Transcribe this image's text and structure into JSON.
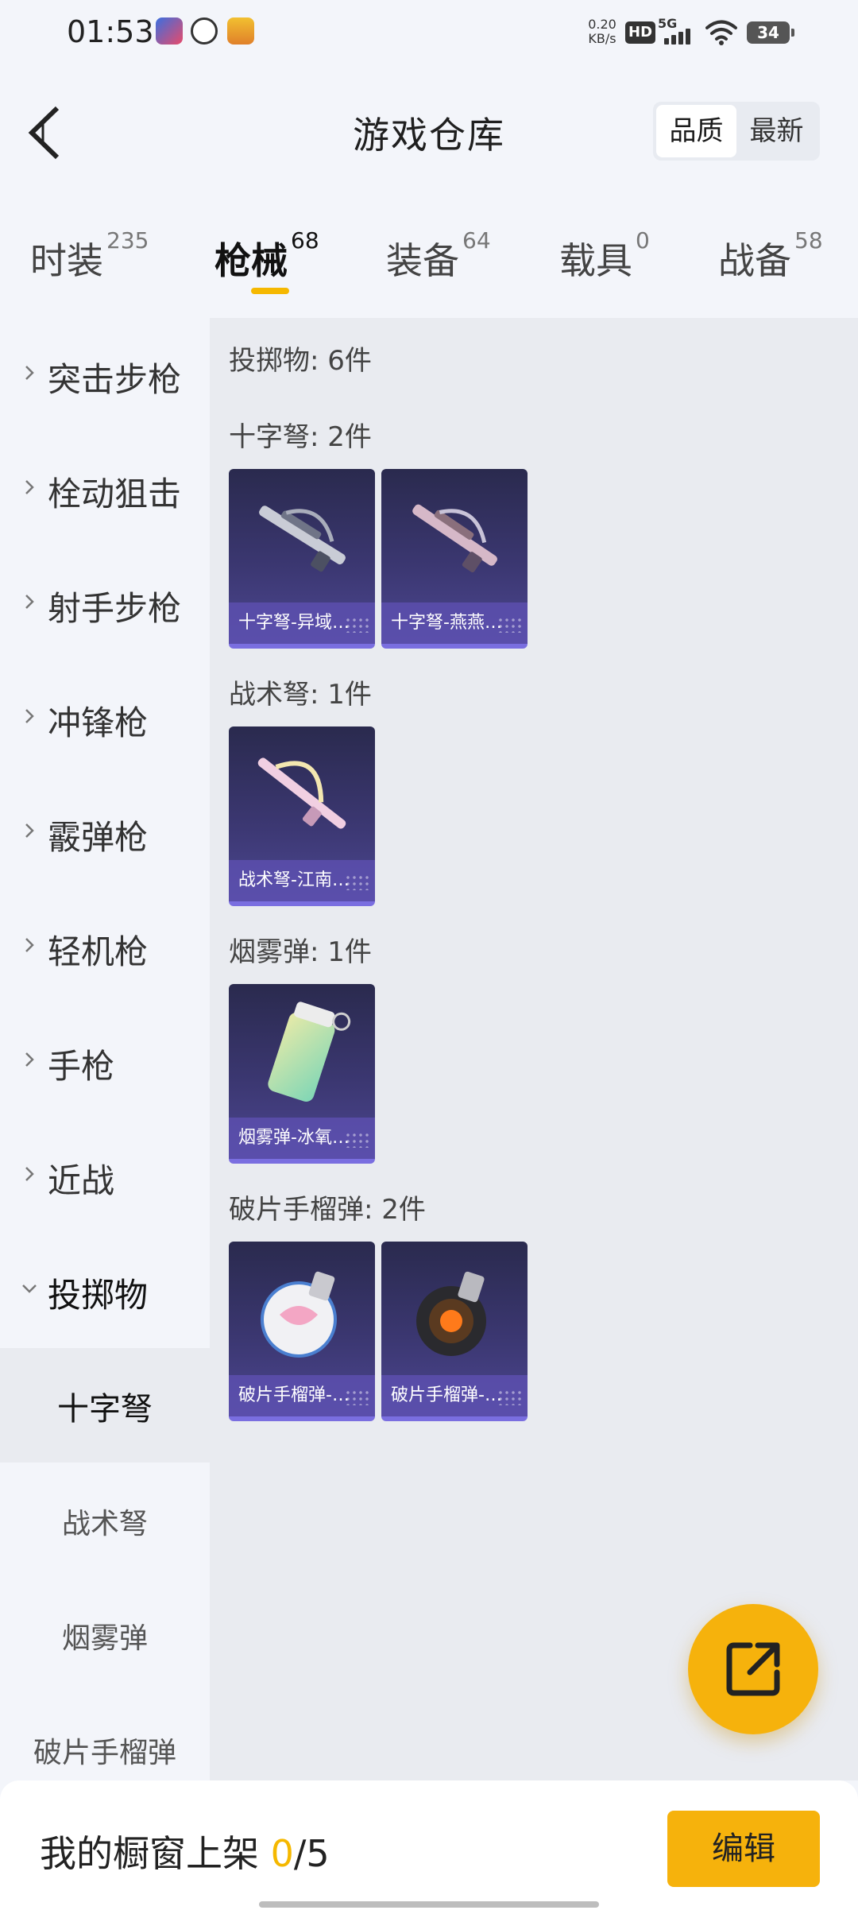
{
  "status_bar": {
    "time": "01:53",
    "net_speed_value": "0.20",
    "net_speed_unit": "KB/s",
    "hd_label": "HD",
    "network_type": "5G",
    "battery": "34"
  },
  "header": {
    "title": "游戏仓库",
    "sort_options": [
      "品质",
      "最新"
    ],
    "sort_selected": "品质"
  },
  "tabs": [
    {
      "label": "时装",
      "count": "235"
    },
    {
      "label": "枪械",
      "count": "68"
    },
    {
      "label": "装备",
      "count": "64"
    },
    {
      "label": "载具",
      "count": "0"
    },
    {
      "label": "战备",
      "count": "58"
    }
  ],
  "active_tab": "枪械",
  "sidebar": {
    "categories": [
      "突击步枪",
      "栓动狙击",
      "射手步枪",
      "冲锋枪",
      "霰弹枪",
      "轻机枪",
      "手枪",
      "近战",
      "投掷物"
    ],
    "expanded": "投掷物",
    "subcategories": [
      "十字弩",
      "战术弩",
      "烟雾弹",
      "破片手榴弹"
    ],
    "active_sub": "十字弩"
  },
  "content": {
    "summary": "投掷物: 6件",
    "sections": [
      {
        "title": "十字弩: 2件",
        "items": [
          "十字弩-异域…",
          "十字弩-燕燕…"
        ]
      },
      {
        "title": "战术弩: 1件",
        "items": [
          "战术弩-江南…"
        ]
      },
      {
        "title": "烟雾弹: 1件",
        "items": [
          "烟雾弹-冰氧…"
        ]
      },
      {
        "title": "破片手榴弹: 2件",
        "items": [
          "破片手榴弹-…",
          "破片手榴弹-…"
        ]
      }
    ]
  },
  "bottom_bar": {
    "label": "我的橱窗上架 ",
    "count_current": "0",
    "count_total": "/5",
    "edit_label": "编辑"
  },
  "colors": {
    "accent": "#f6b20c",
    "card_bg": "#3b3771",
    "card_caption": "#5f52b4",
    "page_bg": "#f3f5fa",
    "content_bg": "#e9ebf0"
  },
  "icons": [
    "back-arrow-icon",
    "chevron-right-icon",
    "chevron-down-icon",
    "share-edit-icon",
    "wifi-icon",
    "signal-icon",
    "battery-icon"
  ]
}
